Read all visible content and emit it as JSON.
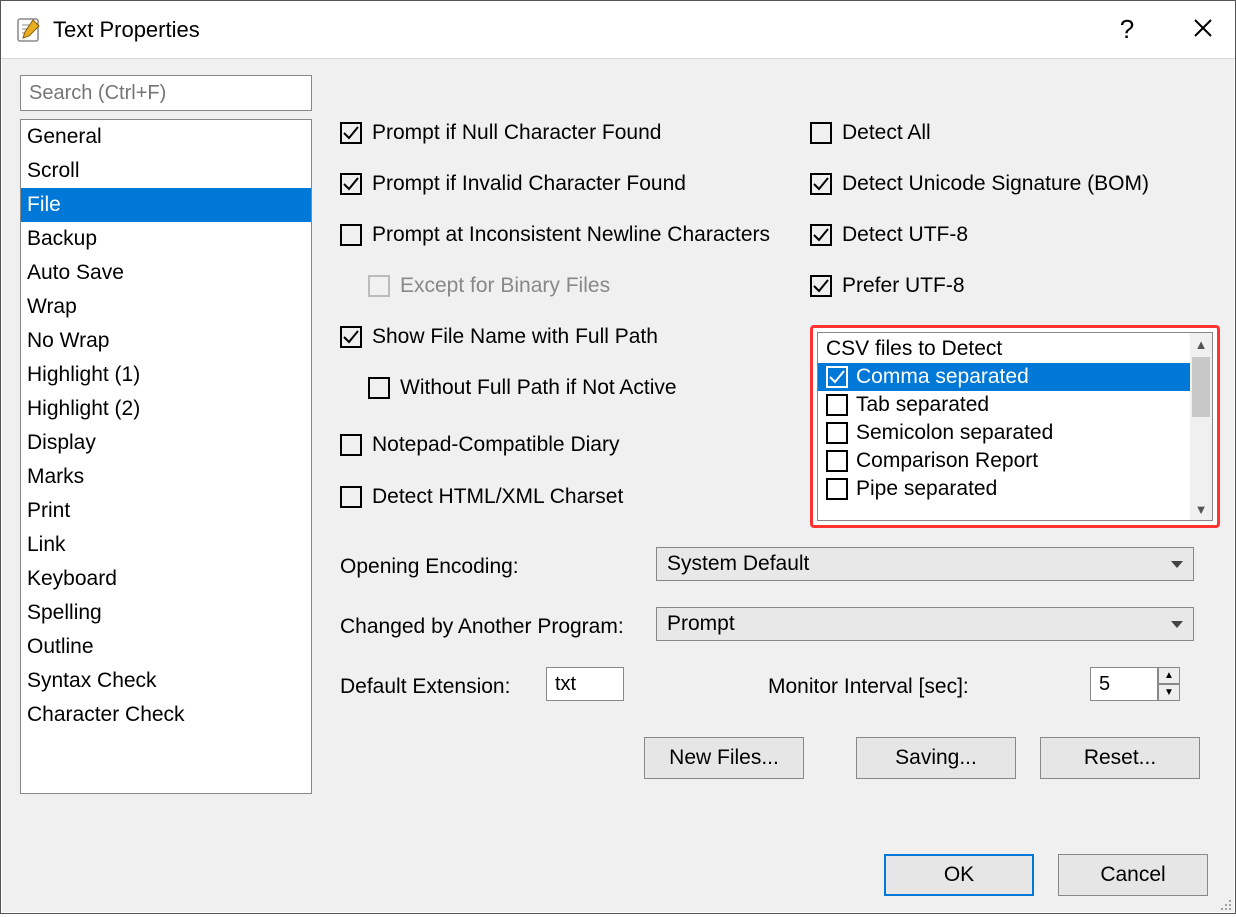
{
  "window": {
    "title": "Text Properties"
  },
  "search": {
    "placeholder": "Search (Ctrl+F)"
  },
  "categories": [
    "General",
    "Scroll",
    "File",
    "Backup",
    "Auto Save",
    "Wrap",
    "No Wrap",
    "Highlight (1)",
    "Highlight (2)",
    "Display",
    "Marks",
    "Print",
    "Link",
    "Keyboard",
    "Spelling",
    "Outline",
    "Syntax Check",
    "Character Check"
  ],
  "categories_selected_index": 2,
  "left_checks": {
    "prompt_null": "Prompt if Null Character Found",
    "prompt_invalid": "Prompt if Invalid Character Found",
    "prompt_newline": "Prompt at Inconsistent Newline Characters",
    "except_binary": "Except for Binary Files",
    "show_full_path": "Show File Name with Full Path",
    "without_full_path": "Without Full Path if Not Active",
    "notepad_diary": "Notepad-Compatible Diary",
    "detect_charset": "Detect HTML/XML Charset"
  },
  "right_checks": {
    "detect_all": "Detect All",
    "detect_bom": "Detect Unicode Signature (BOM)",
    "detect_utf8": "Detect UTF-8",
    "prefer_utf8": "Prefer UTF-8"
  },
  "csv": {
    "title": "CSV files to Detect",
    "items": [
      {
        "label": "Comma separated",
        "checked": true,
        "selected": true
      },
      {
        "label": "Tab separated",
        "checked": false,
        "selected": false
      },
      {
        "label": "Semicolon separated",
        "checked": false,
        "selected": false
      },
      {
        "label": "Comparison Report",
        "checked": false,
        "selected": false
      },
      {
        "label": "Pipe separated",
        "checked": false,
        "selected": false
      }
    ]
  },
  "labels": {
    "opening_encoding": "Opening Encoding:",
    "changed_by": "Changed by Another Program:",
    "default_ext": "Default Extension:",
    "monitor_interval": "Monitor Interval [sec]:"
  },
  "values": {
    "opening_encoding": "System Default",
    "changed_by": "Prompt",
    "default_ext": "txt",
    "monitor_interval": "5"
  },
  "buttons": {
    "new_files": "New Files...",
    "saving": "Saving...",
    "reset": "Reset...",
    "ok": "OK",
    "cancel": "Cancel"
  }
}
